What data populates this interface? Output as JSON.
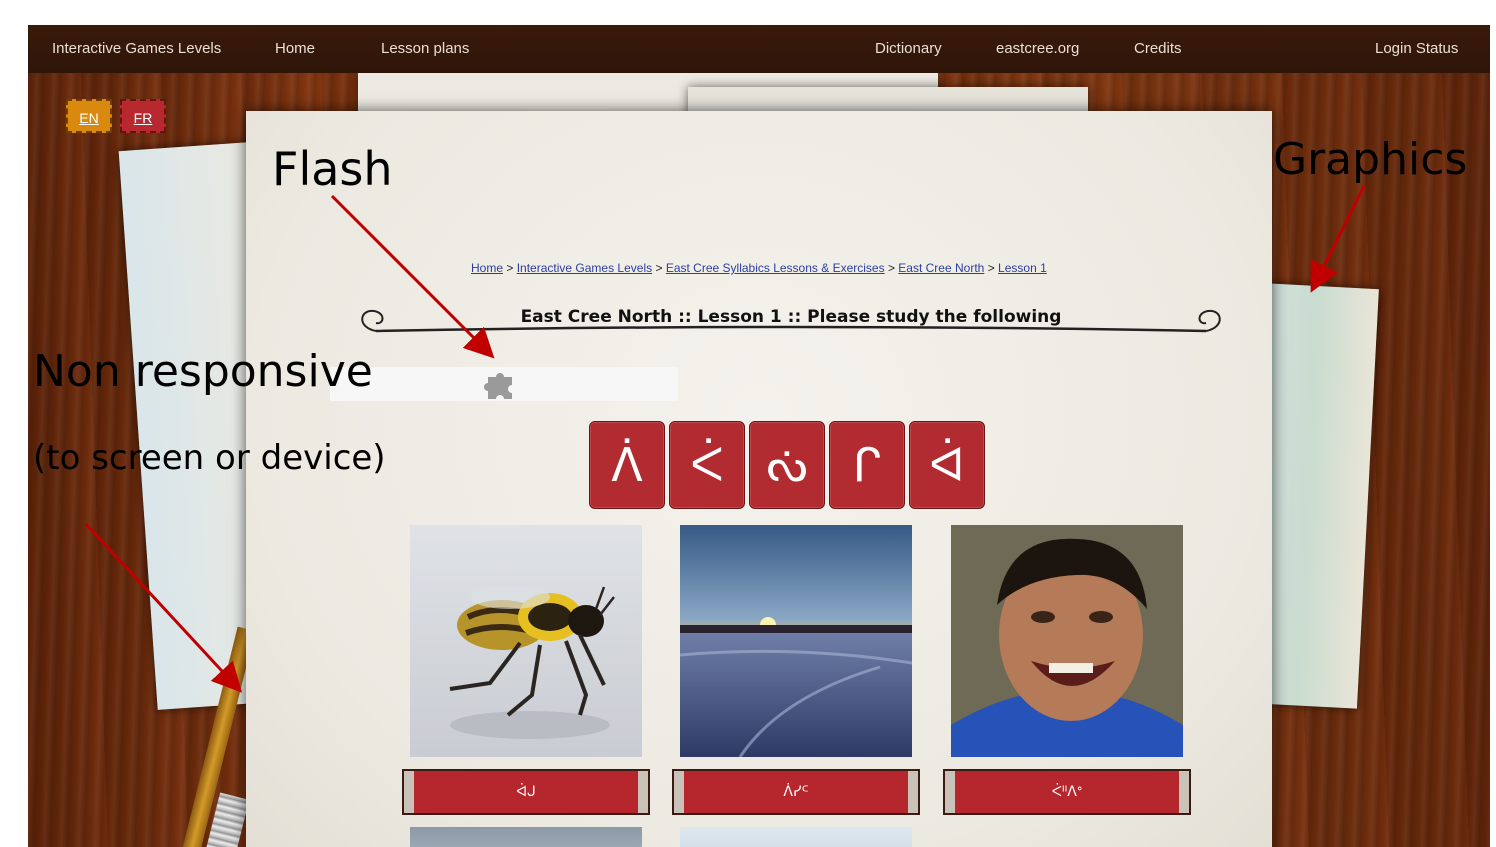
{
  "navbar": {
    "brand": "Interactive Games Levels",
    "home": "Home",
    "lesson_plans": "Lesson plans",
    "dictionary": "Dictionary",
    "eastcree": "eastcree.org",
    "credits": "Credits",
    "login_status": "Login Status"
  },
  "language": {
    "en": "EN",
    "fr": "FR"
  },
  "breadcrumb": {
    "home": "Home",
    "games": "Interactive Games Levels",
    "lessons": "East Cree Syllabics Lessons & Exercises",
    "north": "East Cree North",
    "lesson": "Lesson 1",
    "sep": ">"
  },
  "heading": "East Cree North :: Lesson 1 :: Please study the following",
  "tiles": [
    "ᐲ",
    "ᐹ",
    "ᔔ",
    "ᒋ",
    "ᐋ"
  ],
  "cards": [
    {
      "label": "ᐋᒍ",
      "image": "bee"
    },
    {
      "label": "ᐲᓯᒼ",
      "image": "sunset"
    },
    {
      "label": "ᐹᐦᐱᐤ",
      "image": "smiling-child"
    }
  ],
  "annotations": {
    "flash": "Flash",
    "graphics": "Graphics",
    "non_responsive": "Non responsive",
    "screen_device": "(to screen or device)"
  },
  "colors": {
    "navbar": "#2e1508",
    "tile": "#b22b30",
    "en_button": "#d98a0e",
    "fr_button": "#b8282f",
    "arrow": "#c00000"
  }
}
